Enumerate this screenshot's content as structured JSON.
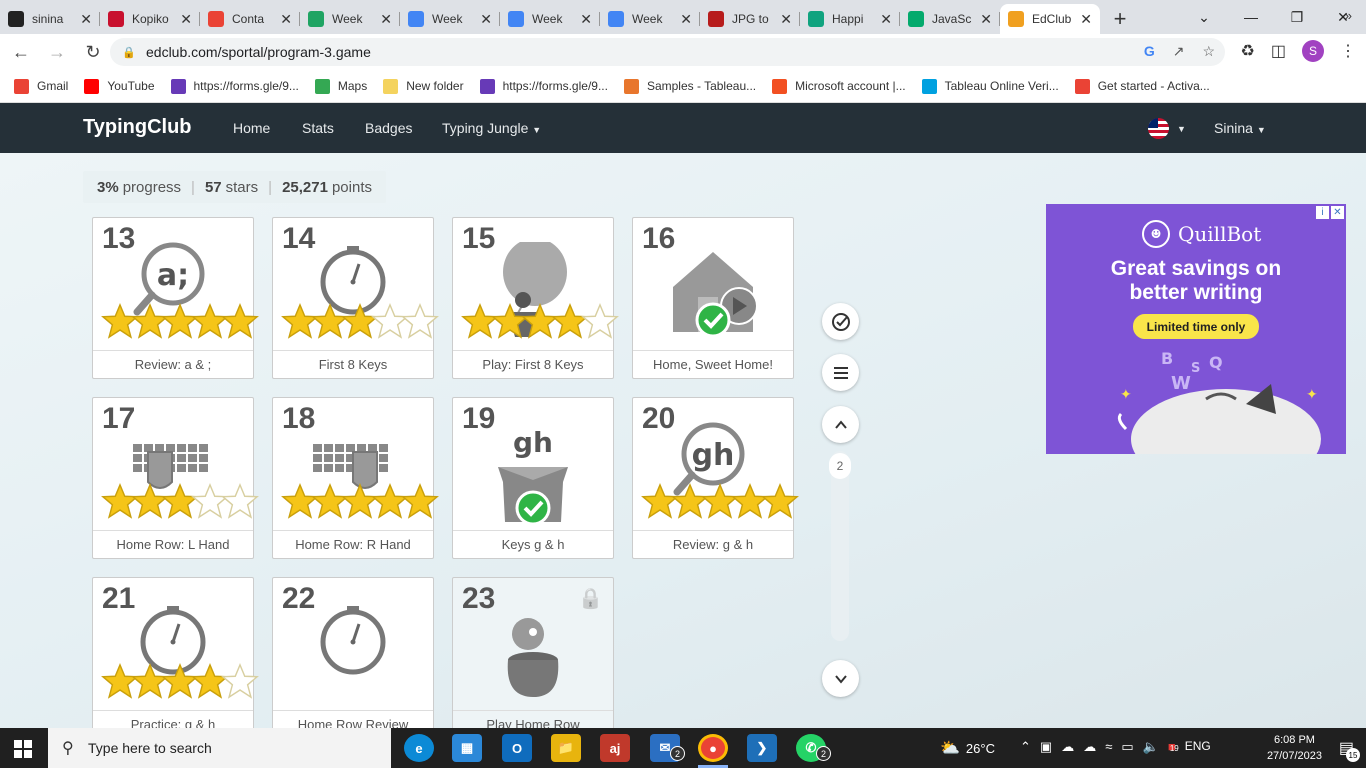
{
  "tabs": [
    {
      "title": "sinina",
      "icon": "github-icon",
      "color": "#222"
    },
    {
      "title": "Kopiko",
      "icon": "kopiko-icon",
      "color": "#c8102e"
    },
    {
      "title": "Conta",
      "icon": "gmail-icon",
      "color": "#ea4335"
    },
    {
      "title": "Week",
      "icon": "drive-icon",
      "color": "#1fa463"
    },
    {
      "title": "Week",
      "icon": "docs-icon",
      "color": "#4285f4"
    },
    {
      "title": "Week",
      "icon": "docs-icon",
      "color": "#4285f4"
    },
    {
      "title": "Week",
      "icon": "docs-icon",
      "color": "#4285f4"
    },
    {
      "title": "JPG to",
      "icon": "jpg-icon",
      "color": "#b71c1c"
    },
    {
      "title": "Happi",
      "icon": "chatgpt-icon",
      "color": "#10a37f"
    },
    {
      "title": "JavaSc",
      "icon": "w3-icon",
      "color": "#04aa6d"
    },
    {
      "title": "EdClub",
      "icon": "edclub-icon",
      "color": "#f0a020",
      "active": true
    }
  ],
  "address": {
    "url": "edclub.com/sportal/program-3.game",
    "profile_initial": "S"
  },
  "bookmarks": [
    {
      "label": "Gmail",
      "icon": "gmail-icon",
      "color": "#ea4335"
    },
    {
      "label": "YouTube",
      "icon": "youtube-icon",
      "color": "#ff0000"
    },
    {
      "label": "https://forms.gle/9...",
      "icon": "forms-icon",
      "color": "#673ab7"
    },
    {
      "label": "Maps",
      "icon": "maps-icon",
      "color": "#34a853"
    },
    {
      "label": "New folder",
      "icon": "folder-icon",
      "color": "#f4d35e"
    },
    {
      "label": "https://forms.gle/9...",
      "icon": "forms-icon",
      "color": "#673ab7"
    },
    {
      "label": "Samples - Tableau...",
      "icon": "tableau-icon",
      "color": "#e8762d"
    },
    {
      "label": "Microsoft account |...",
      "icon": "microsoft-icon",
      "color": "#f25022"
    },
    {
      "label": "Tableau Online Veri...",
      "icon": "salesforce-icon",
      "color": "#00a1e0"
    },
    {
      "label": "Get started - Activa...",
      "icon": "gmail-icon",
      "color": "#ea4335"
    }
  ],
  "site": {
    "logo": "TypingClub",
    "nav": [
      "Home",
      "Stats",
      "Badges",
      "Typing Jungle"
    ],
    "user": "Sinina"
  },
  "progress": {
    "percent": "3%",
    "percent_label": "progress",
    "stars": "57",
    "stars_label": "stars",
    "points": "25,271",
    "points_label": "points"
  },
  "lessons": [
    {
      "num": "13",
      "label": "Review: a & ;",
      "stars": 5,
      "kind": "magnifier",
      "text": "a;"
    },
    {
      "num": "14",
      "label": "First 8 Keys",
      "stars": 3,
      "kind": "stopwatch"
    },
    {
      "num": "15",
      "label": "Play: First 8 Keys",
      "stars": 4,
      "kind": "balloon"
    },
    {
      "num": "16",
      "label": "Home, Sweet Home!",
      "stars": 0,
      "kind": "house",
      "done": true
    },
    {
      "num": "17",
      "label": "Home Row: L Hand",
      "stars": 3,
      "kind": "keyboard-left"
    },
    {
      "num": "18",
      "label": "Home Row: R Hand",
      "stars": 5,
      "kind": "keyboard-right"
    },
    {
      "num": "19",
      "label": "Keys g & h",
      "stars": 0,
      "kind": "box",
      "text": "gh",
      "done": true
    },
    {
      "num": "20",
      "label": "Review: g & h",
      "stars": 5,
      "kind": "magnifier",
      "text": "gh"
    },
    {
      "num": "21",
      "label": "Practice: g & h",
      "stars": 4,
      "kind": "stopwatch"
    },
    {
      "num": "22",
      "label": "Home Row Review",
      "stars": 0,
      "kind": "stopwatch"
    },
    {
      "num": "23",
      "label": "Play Home Row",
      "stars": 0,
      "kind": "pot",
      "locked": true
    }
  ],
  "pager": {
    "page": "2"
  },
  "ad": {
    "brand": "QuillBot",
    "headline_1": "Great savings on",
    "headline_2": "better writing",
    "cta": "Limited time only"
  },
  "taskbar": {
    "search_placeholder": "Type here to search",
    "weather": "26°C",
    "lang": "ENG",
    "time": "6:08 PM",
    "date": "27/07/2023",
    "notifications": "15",
    "mail_badge": "2",
    "whatsapp_badge": "2",
    "calendar_badge": "19"
  },
  "colors": {
    "star": "#f5c518",
    "nav_bg": "#253038",
    "ad_bg": "#7e54d6",
    "check": "#2fb446"
  }
}
